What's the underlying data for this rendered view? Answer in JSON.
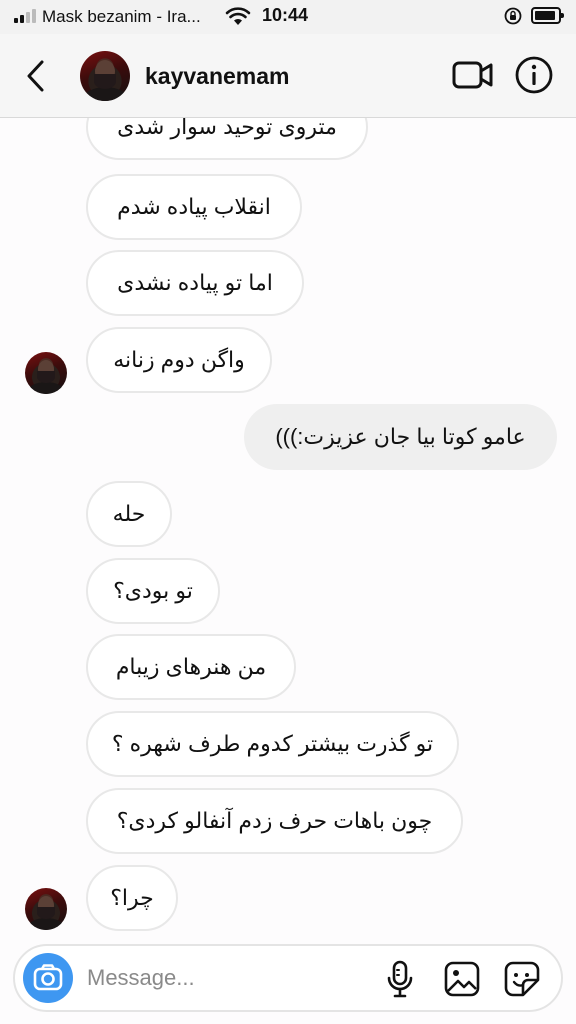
{
  "status_bar": {
    "carrier": "Mask bezanim - Ira...",
    "time": "10:44"
  },
  "header": {
    "username": "kayvanemam"
  },
  "messages": [
    {
      "text": "متروی توحید سوار شدی",
      "side": "in"
    },
    {
      "text": "انقلاب پیاده شدم",
      "side": "in"
    },
    {
      "text": "اما تو پیاده نشدی",
      "side": "in"
    },
    {
      "text": "واگن دوم زنانه",
      "side": "in"
    },
    {
      "text": "عامو کوتا بیا جان عزیزت:)))",
      "side": "out"
    },
    {
      "text": "حله",
      "side": "in"
    },
    {
      "text": "تو بودی؟",
      "side": "in"
    },
    {
      "text": "من هنرهای زیبام",
      "side": "in"
    },
    {
      "text": "تو گذرت بیشتر کدوم طرف شهره ؟",
      "side": "in"
    },
    {
      "text": "چون باهات حرف زدم آنفالو کردی؟",
      "side": "in"
    },
    {
      "text": "چرا؟",
      "side": "in"
    }
  ],
  "composer": {
    "placeholder": "Message..."
  },
  "colors": {
    "camera_button": "#3e97f1",
    "incoming_bubble": "#ffffff",
    "outgoing_bubble": "#efefef"
  },
  "icons": [
    "back-icon",
    "video-call-icon",
    "info-icon",
    "camera-icon",
    "microphone-icon",
    "gallery-icon",
    "sticker-icon"
  ]
}
